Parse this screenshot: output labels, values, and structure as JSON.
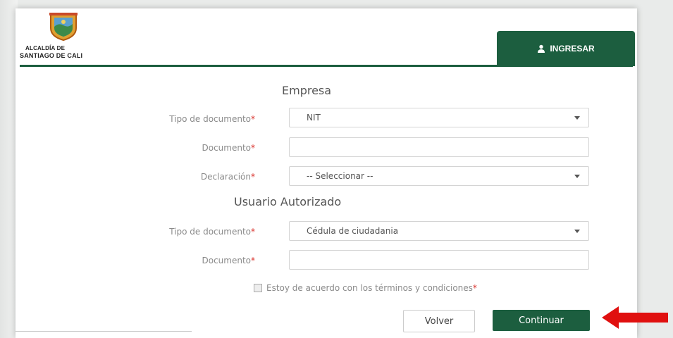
{
  "header": {
    "logo_line1": "ALCALDÍA DE",
    "logo_line2": "SANTIAGO DE CALI",
    "tab_label": "INGRESAR"
  },
  "form": {
    "empresa_title": "Empresa",
    "empresa": {
      "doc_type_label": "Tipo de documento",
      "doc_type_value": "NIT",
      "document_label": "Documento",
      "document_value": "",
      "declaration_label": "Declaración",
      "declaration_value": "-- Seleccionar --"
    },
    "usuario_title": "Usuario Autorizado",
    "usuario": {
      "doc_type_label": "Tipo de documento",
      "doc_type_value": "Cédula de ciudadania",
      "document_label": "Documento",
      "document_value": ""
    },
    "required_mark": "*",
    "terms_label": "Estoy de acuerdo con los términos y condiciones",
    "back_label": "Volver",
    "continue_label": "Continuar"
  },
  "colors": {
    "brand_green": "#1c5e3f",
    "required_red": "#d9322c",
    "arrow_red": "#e0100f"
  },
  "icons": [
    "user-icon",
    "crest-icon",
    "chevron-down-icon",
    "checkbox-icon",
    "arrow-left-icon"
  ]
}
